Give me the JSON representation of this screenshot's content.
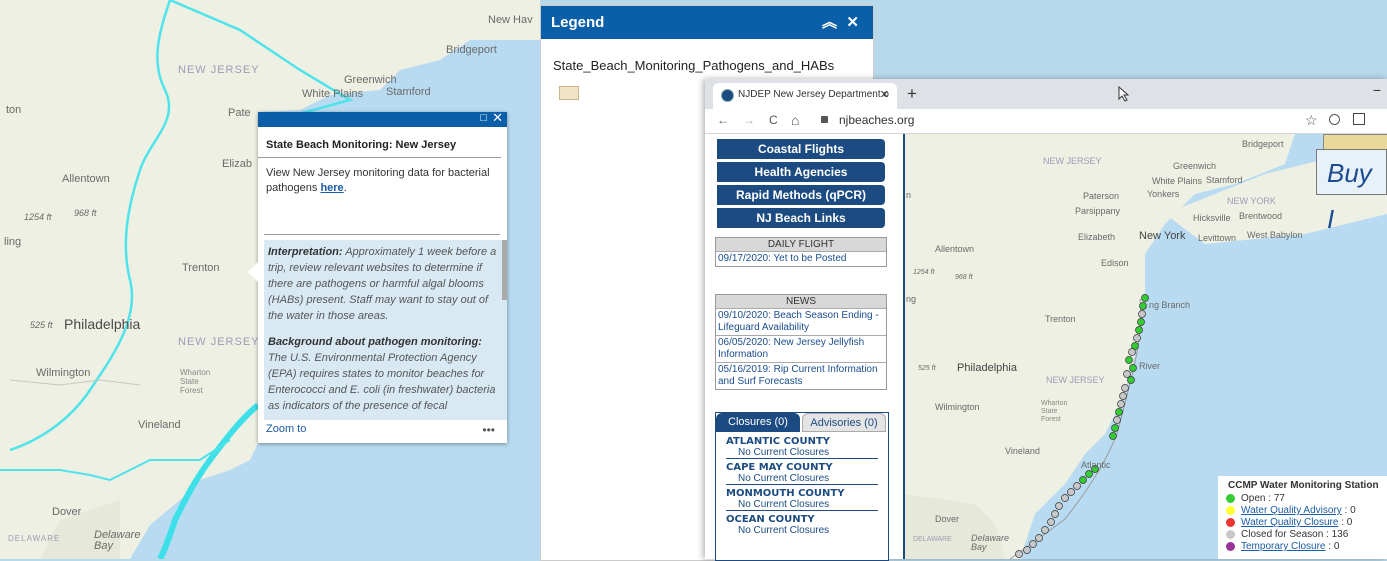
{
  "map": {
    "labels": {
      "new_jersey": "NEW JERSEY",
      "new_jersey_2": "NEW JERSEY",
      "philadelphia": "Philadelphia",
      "trenton": "Trenton",
      "allentown": "Allentown",
      "vineland": "Vineland",
      "wilmington": "Wilmington",
      "dover": "Dover",
      "delaware": "DELAWARE",
      "delaware_bay": "Delaware\nBay",
      "wharton": "Wharton\nState\nForest",
      "bridgeport": "Bridgeport",
      "greenwich": "Greenwich",
      "white_plains": "White Plains",
      "stamford": "Stamford",
      "elizab": "Elizab",
      "new_hav": "New Hav",
      "pate": "Pate",
      "elev1": "1254 ft",
      "elev2": "968 ft",
      "elev3": "525 ft",
      "ling": "ling",
      "ton": "ton"
    }
  },
  "popup": {
    "title": "State Beach Monitoring: New Jersey",
    "body_pre": "View New Jersey monitoring data for bacterial pathogens ",
    "body_link": "here",
    "body_post": ".",
    "interp_label": "Interpretation:",
    "interp_text": " Approximately 1 week before a trip, review relevant websites to determine if there are pathogens or harmful algal blooms (HABs) present. Staff may want to stay out of the water in those areas.",
    "bg_label": "Background about pathogen monitoring:",
    "bg_text": "The U.S. Environmental Protection Agency (EPA) requires states to monitor beaches for Enterococci and E. coli (in freshwater) bacteria as indicators of the presence of fecal",
    "zoom": "Zoom to",
    "more": "•••",
    "maximize_icon": "□",
    "close_icon": "✕"
  },
  "legend": {
    "title": "Legend",
    "collapse_icon": "︽",
    "close_icon": "✕",
    "layer_name": "State_Beach_Monitoring_Pathogens_and_HABs"
  },
  "browser": {
    "tab_title": "NJDEP New Jersey Department o",
    "tab_close": "✕",
    "new_tab": "+",
    "url": "njbeaches.org",
    "back": "←",
    "forward": "→",
    "reload": "C",
    "home": "⌂",
    "star": "☆",
    "minimize": "−"
  },
  "site": {
    "nav": [
      "Coastal Flights",
      "Health Agencies",
      "Rapid Methods (qPCR)",
      "NJ Beach Links"
    ],
    "daily_flight": {
      "header": "DAILY FLIGHT",
      "items": [
        "09/17/2020: Yet to be Posted"
      ]
    },
    "news": {
      "header": "NEWS",
      "items": [
        "09/10/2020: Beach Season Ending - Lifeguard Availability",
        "06/05/2020: New Jersey Jellyfish Information",
        "05/16/2019: Rip Current Information and Surf Forecasts"
      ]
    },
    "closures_tab": "Closures (0)",
    "advisories_tab": "Advisories (0)",
    "counties": [
      {
        "name": "ATLANTIC COUNTY",
        "status": "No Current Closures"
      },
      {
        "name": "CAPE MAY COUNTY",
        "status": "No Current Closures"
      },
      {
        "name": "MONMOUTH COUNTY",
        "status": "No Current Closures"
      },
      {
        "name": "OCEAN COUNTY",
        "status": "No Current Closures"
      }
    ],
    "buy_text": "Buy I",
    "rmap_labels": {
      "bridgeport": "Bridgeport",
      "greenwich": "Greenwich",
      "white_plains": "White Plains",
      "stamford": "Stamford",
      "new_jersey": "NEW JERSEY",
      "new_jersey2": "NEW JERSEY",
      "paterson": "Paterson",
      "yonkers": "Yonkers",
      "new_york_state": "NEW YORK",
      "parsippany": "Parsippany",
      "hicksville": "Hicksville",
      "brentwood": "Brentwood",
      "elizabeth": "Elizabeth",
      "new_york": "New York",
      "levittown": "Levittown",
      "west_babylon": "West Babylon",
      "allentown": "Allentown",
      "edison": "Edison",
      "trenton": "Trenton",
      "philadelphia": "Philadelphia",
      "wilmington": "Wilmington",
      "wharton": "Wharton\nState\nForest",
      "vineland": "Vineland",
      "atlantic": "Atlantic",
      "dover": "Dover",
      "delaware": "DELAWARE",
      "delaware_bay": "Delaware\nBay",
      "long_branch": "ng Branch",
      "river": "River",
      "e1": "1254 ft",
      "e2": "968 ft",
      "e3": "525 ft",
      "ng": "ng",
      "n": "n"
    },
    "stations": {
      "title": "CCMP Water Monitoring Station",
      "rows": [
        {
          "color": "#33cc33",
          "label": "Open",
          "sep": " : ",
          "count": "77",
          "link": false
        },
        {
          "color": "#ffff33",
          "label": "Water Quality Advisory",
          "sep": " : ",
          "count": "0",
          "link": true
        },
        {
          "color": "#ee3333",
          "label": "Water Quality Closure",
          "sep": " : ",
          "count": "0",
          "link": true
        },
        {
          "color": "#c8c8c8",
          "label": "Closed for Season",
          "sep": " : ",
          "count": "136",
          "link": false
        },
        {
          "color": "#993399",
          "label": "Temporary Closure",
          "sep": " : ",
          "count": "0",
          "link": true
        }
      ]
    }
  }
}
